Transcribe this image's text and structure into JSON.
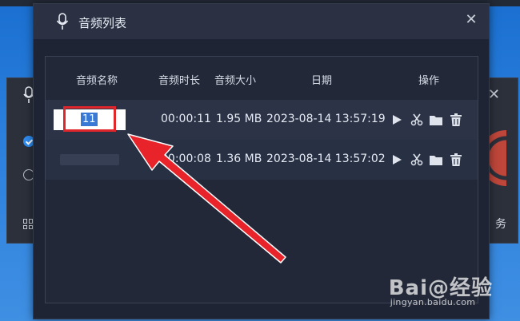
{
  "background_window": {
    "partial_text": "务"
  },
  "dialog": {
    "title": "音频列表",
    "close_symbol": "✕"
  },
  "table": {
    "headers": {
      "name": "音频名称",
      "duration": "音频时长",
      "size": "音频大小",
      "date": "日期",
      "actions": "操作"
    },
    "rows": [
      {
        "name": "11",
        "duration": "00:00:11",
        "size": "1.95 MB",
        "date": "2023-08-14 13:57:19",
        "editing": true
      },
      {
        "name": "",
        "duration": "00:00:08",
        "size": "1.36 MB",
        "date": "2023-08-14 13:57:02",
        "editing": false
      }
    ],
    "action_icons": [
      "play-icon",
      "scissors-icon",
      "folder-icon",
      "trash-icon"
    ]
  },
  "annotation": {
    "highlight_color": "#e0262a",
    "arrow_color": "#e8242a"
  },
  "watermark": {
    "logo": "Bai@经验",
    "url": "jingyan.baidu.com"
  }
}
